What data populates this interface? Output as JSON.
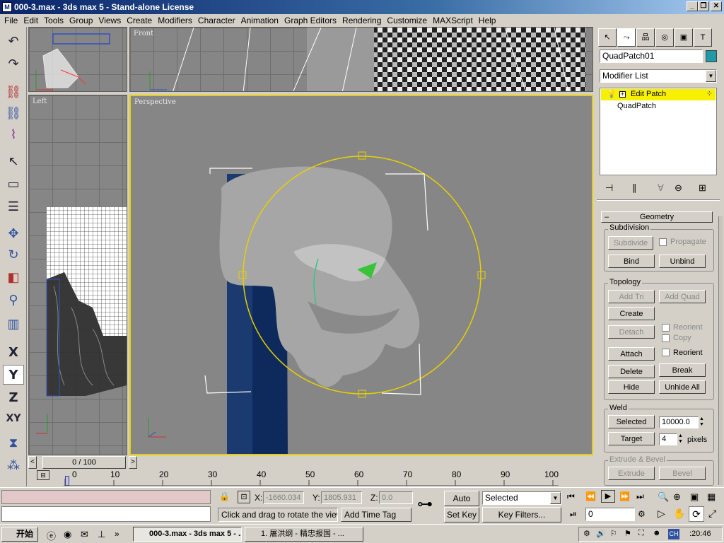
{
  "window": {
    "title": "000-3.max - 3ds max 5 - Stand-alone License",
    "minimize": "_",
    "restore": "❐",
    "close": "✕"
  },
  "menu": [
    "File",
    "Edit",
    "Tools",
    "Group",
    "Views",
    "Create",
    "Modifiers",
    "Character",
    "Animation",
    "Graph Editors",
    "Rendering",
    "Customize",
    "MAXScript",
    "Help"
  ],
  "viewports": {
    "front": "Front",
    "left": "Left",
    "perspective": "Perspective"
  },
  "left_toolbar": {
    "undo": "↶",
    "redo": "↷",
    "link": "⛓",
    "unlink": "⛓",
    "bind": "⌇",
    "select": "↖",
    "region": "▭",
    "name": "☰",
    "move": "✥",
    "rotate": "↻",
    "scale": "◧",
    "ik": "⚲",
    "mirror2": "▥",
    "x": "X",
    "y": "Y",
    "z": "Z",
    "xy": "XY",
    "mirror": "⧗",
    "array": "⁂"
  },
  "command_panel": {
    "tabs": [
      "↖",
      "⤳",
      "品",
      "◎",
      "▣",
      "T"
    ],
    "object_name": "QuadPatch01",
    "object_color": "#1e9aa8",
    "modifier_list": "Modifier List",
    "stack": [
      {
        "label": "Edit Patch",
        "selected": true
      },
      {
        "label": "QuadPatch",
        "selected": false
      }
    ],
    "stack_tools": [
      "⊣",
      "∥",
      "∀",
      "⊖",
      "⊞"
    ],
    "rollout": "Geometry",
    "subdivision": {
      "title": "Subdivision",
      "subdivide": "Subdivide",
      "propagate": "Propagate",
      "bind": "Bind",
      "unbind": "Unbind"
    },
    "topology": {
      "title": "Topology",
      "add_tri": "Add Tri",
      "add_quad": "Add Quad",
      "create": "Create",
      "detach": "Detach",
      "reorient1": "Reorient",
      "copy": "Copy",
      "attach": "Attach",
      "reorient2": "Reorient",
      "delete": "Delete",
      "break": "Break",
      "hide": "Hide",
      "unhide_all": "Unhide All"
    },
    "weld": {
      "title": "Weld",
      "selected": "Selected",
      "threshold": "10000.0",
      "target": "Target",
      "pixels_value": "4",
      "pixels_label": "pixels"
    },
    "extrude": {
      "title": "Extrude & Bevel",
      "extrude": "Extrude",
      "bevel": "Bevel"
    }
  },
  "timeline": {
    "frame_label": "0 / 100",
    "prev": "<",
    "next": ">",
    "ticks": [
      "0",
      "10",
      "20",
      "30",
      "40",
      "50",
      "60",
      "70",
      "80",
      "90",
      "100"
    ]
  },
  "status": {
    "x_label": "X:",
    "x_value": "-1660.034",
    "y_label": "Y:",
    "y_value": "1805.931",
    "z_label": "Z:",
    "z_value": "0.0",
    "prompt": "Click and drag to rotate the view.",
    "add_time_tag": "Add Time Tag",
    "auto_key": "Auto Key",
    "set_key": "Set Key",
    "key_mode": "Selected",
    "key_filters": "Key Filters...",
    "frame_value": "0",
    "key_icon": "⊶"
  },
  "taskbar": {
    "start": "开始",
    "tasks": [
      {
        "label": "000-3.max - 3ds max 5 - ...",
        "active": true
      },
      {
        "label": "1. 屠洪纲 - 精忠报国 - ...",
        "active": false
      }
    ],
    "clock": ":20:46",
    "ime": "CH"
  }
}
